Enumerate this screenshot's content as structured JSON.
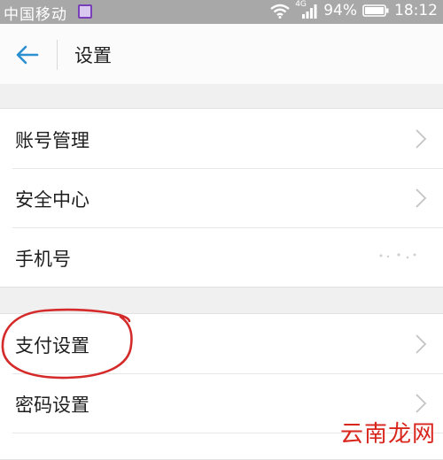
{
  "status_bar": {
    "carrier": "中国移动",
    "network": "4G",
    "battery_percent": "94%",
    "time": "18:12"
  },
  "app_bar": {
    "title": "设置",
    "back_icon": "back-arrow-icon"
  },
  "sections": [
    {
      "items": [
        {
          "label": "账号管理",
          "has_chevron": true
        },
        {
          "label": "安全中心",
          "has_chevron": true
        },
        {
          "label": "手机号",
          "has_chevron": false
        }
      ]
    },
    {
      "items": [
        {
          "label": "支付设置",
          "has_chevron": true,
          "highlighted": true
        },
        {
          "label": "密码设置",
          "has_chevron": true
        }
      ]
    }
  ],
  "watermark": "云南龙网",
  "colors": {
    "status_bar": "#a8a8a8",
    "accent_back_arrow": "#2b8fd1",
    "highlight_circle": "#d42a2a",
    "watermark": "#d8261d"
  }
}
